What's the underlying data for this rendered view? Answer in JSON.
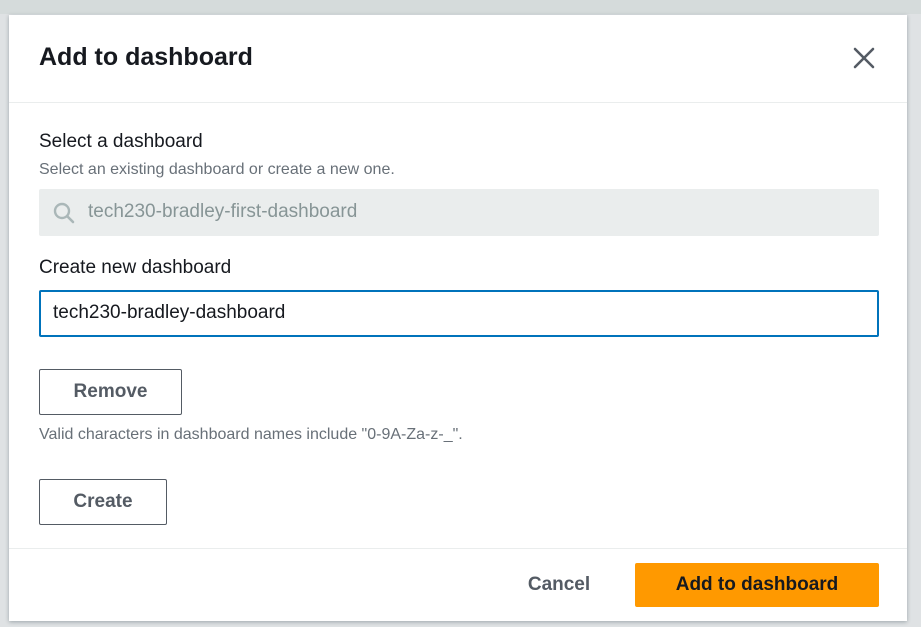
{
  "modal": {
    "title": "Add to dashboard"
  },
  "select_dashboard": {
    "label": "Select a dashboard",
    "description": "Select an existing dashboard or create a new one.",
    "placeholder": "tech230-bradley-first-dashboard",
    "icon": "search-icon"
  },
  "create_dashboard": {
    "label": "Create new dashboard",
    "value": "tech230-bradley-dashboard",
    "remove_label": "Remove",
    "hint": "Valid characters in dashboard names include \"0-9A-Za-z-_\".",
    "create_label": "Create"
  },
  "footer": {
    "cancel_label": "Cancel",
    "submit_label": "Add to dashboard"
  },
  "colors": {
    "primary": "#ff9900",
    "focus_border": "#0073bb",
    "text": "#16191f",
    "muted": "#687078"
  }
}
